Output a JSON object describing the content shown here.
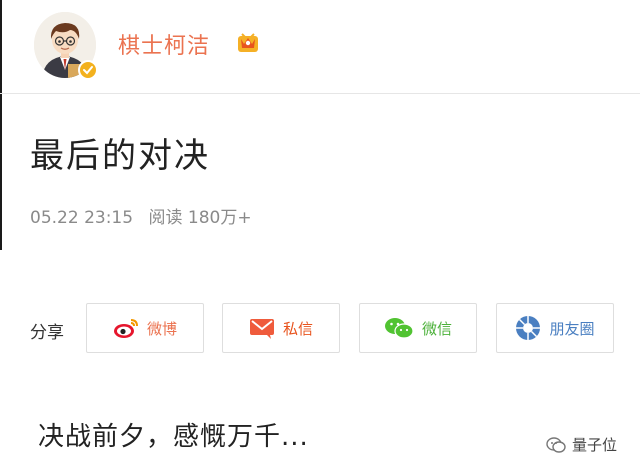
{
  "header": {
    "username": "棋士柯洁",
    "avatar_icon": "cartoon-avatar",
    "verified_icon": "verified-badge-icon",
    "vip_icon": "crown-badge-icon"
  },
  "post": {
    "title": "最后的对决",
    "date": "05.22 23:15",
    "views": "阅读 180万+"
  },
  "share": {
    "label": "分享",
    "buttons": [
      {
        "label": "微博",
        "icon": "weibo-icon",
        "color": "#eb7350"
      },
      {
        "label": "私信",
        "icon": "mail-icon",
        "color": "#e8541e"
      },
      {
        "label": "微信",
        "icon": "wechat-icon",
        "color": "#4cb13a"
      },
      {
        "label": "朋友圈",
        "icon": "moments-icon",
        "color": "#4a7fc1"
      }
    ]
  },
  "content": {
    "text": "决战前夕，感慨万千..."
  },
  "watermark": {
    "text": "量子位"
  },
  "colors": {
    "accent": "#eb7350",
    "meta": "#8a8a8a"
  }
}
